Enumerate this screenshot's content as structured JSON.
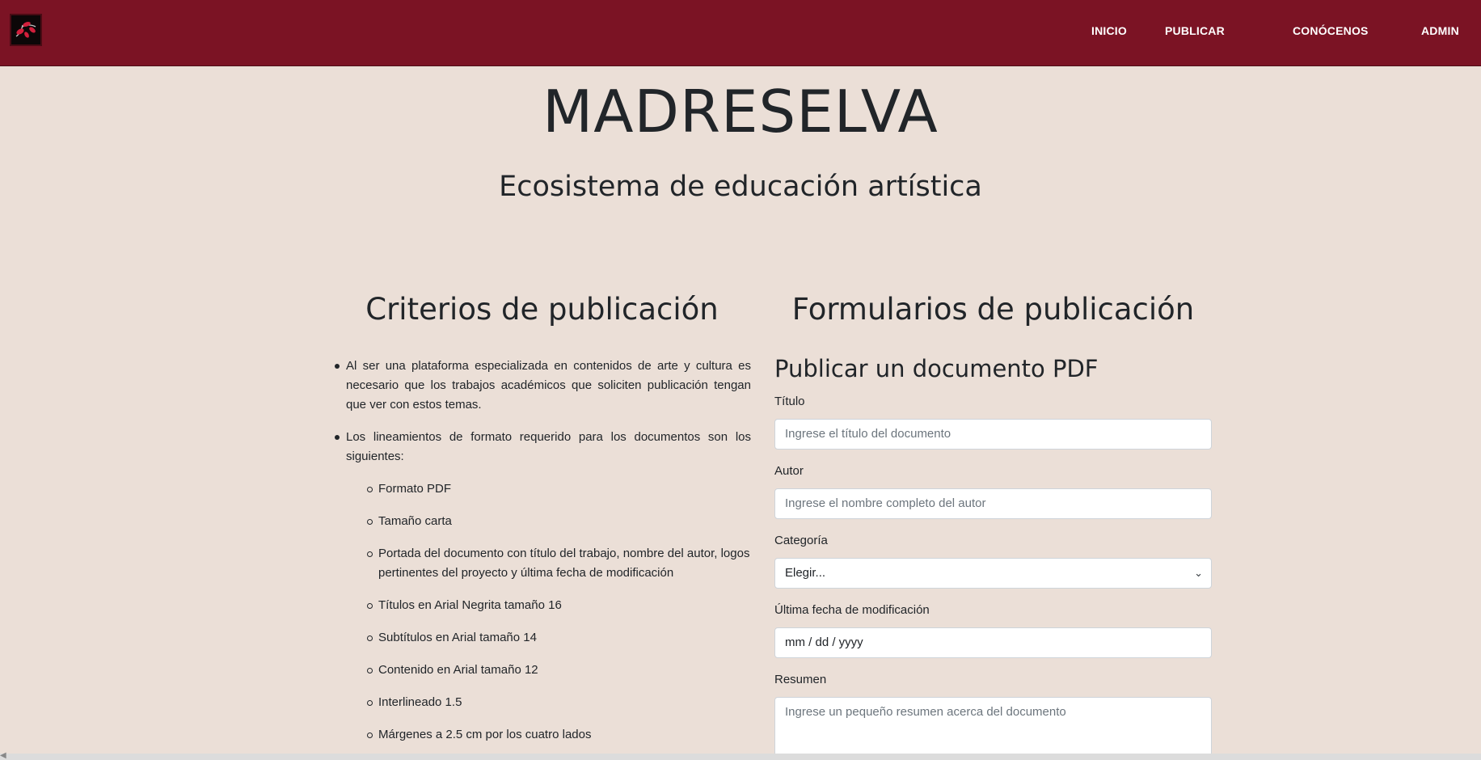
{
  "nav": {
    "items": [
      {
        "label": "INICIO"
      },
      {
        "label": "PUBLICAR"
      },
      {
        "label": "CONÓCENOS"
      },
      {
        "label": "ADMIN"
      }
    ]
  },
  "hero": {
    "title": "MADRESELVA",
    "subtitle": "Ecosistema de educación artística"
  },
  "criteria": {
    "title": "Criterios de publicación",
    "items": [
      "Al ser una plataforma especializada en contenidos de arte y cultura es necesario que los trabajos académicos que soliciten publicación tengan que ver con estos temas.",
      "Los lineamientos de formato requerido para los documentos son los siguientes:"
    ],
    "sub_items": [
      "Formato PDF",
      "Tamaño carta",
      "Portada del documento con título del trabajo, nombre del autor, logos pertinentes del proyecto y última fecha de modificación",
      "Títulos en Arial Negrita tamaño 16",
      "Subtítulos en Arial tamaño 14",
      "Contenido en Arial tamaño 12",
      "Interlineado 1.5",
      "Márgenes a 2.5 cm por los cuatro lados"
    ]
  },
  "forms": {
    "title": "Formularios de publicación",
    "pdf_form": {
      "title": "Publicar un documento PDF",
      "fields": [
        {
          "label": "Título",
          "placeholder": "Ingrese el título del documento"
        },
        {
          "label": "Autor",
          "placeholder": "Ingrese el nombre completo del autor"
        },
        {
          "label": "Categoría",
          "value": "Elegir..."
        },
        {
          "label": "Última fecha de modificación",
          "placeholder": "mm / dd / yyyy"
        },
        {
          "label": "Resumen",
          "placeholder": "Ingrese un pequeño resumen acerca del documento"
        }
      ]
    }
  },
  "colors": {
    "navbar": "#7b1324",
    "background": "#ebdfd7"
  },
  "icons": {
    "logo": "madreselva-leaf-logo",
    "select": "chevron-down-icon"
  }
}
